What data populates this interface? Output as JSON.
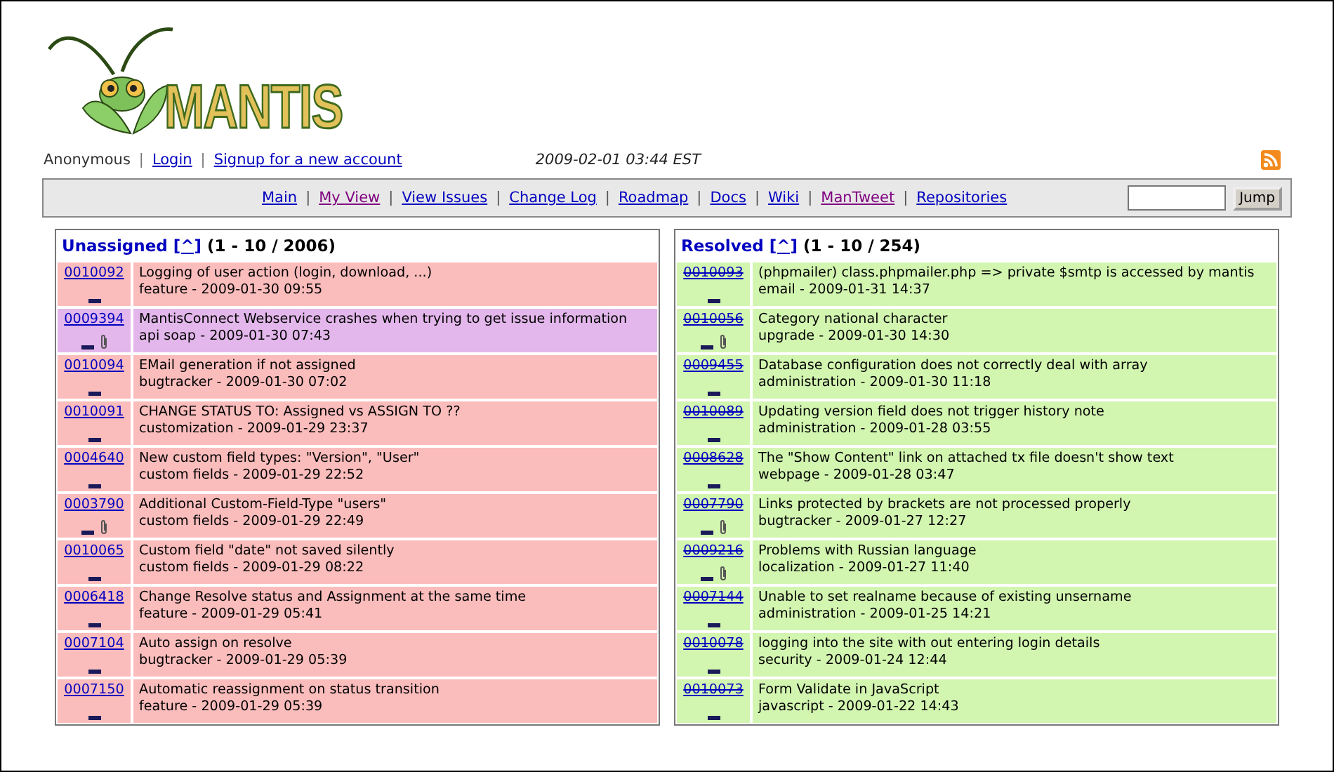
{
  "logo": {
    "text": "MANTIS"
  },
  "user_bar": {
    "user": "Anonymous",
    "separator": "|",
    "links": [
      {
        "label": "Login"
      },
      {
        "label": "Signup for a new account"
      }
    ],
    "datetime": "2009-02-01 03:44 EST"
  },
  "nav": {
    "separator": "|",
    "links": [
      {
        "label": "Main",
        "visited": false
      },
      {
        "label": "My View",
        "visited": true
      },
      {
        "label": "View Issues",
        "visited": false
      },
      {
        "label": "Change Log",
        "visited": false
      },
      {
        "label": "Roadmap",
        "visited": false
      },
      {
        "label": "Docs",
        "visited": false
      },
      {
        "label": "Wiki",
        "visited": false
      },
      {
        "label": "ManTweet",
        "visited": true
      },
      {
        "label": "Repositories",
        "visited": false
      }
    ],
    "jump_button": "Jump"
  },
  "panels": [
    {
      "title": "Unassigned",
      "toggle": "[^]",
      "range": "(1 - 10 / 2006)",
      "issues": [
        {
          "id": "0010092",
          "summary": "Logging of user action (login, download, ...)",
          "meta": "feature - 2009-01-30 09:55",
          "color": "#fbbcbc",
          "resolved": false,
          "attachment": false
        },
        {
          "id": "0009394",
          "summary": "MantisConnect Webservice crashes when trying to get issue information",
          "meta": "api soap - 2009-01-30 07:43",
          "color": "#e3b7eb",
          "resolved": false,
          "attachment": true
        },
        {
          "id": "0010094",
          "summary": "EMail generation if not assigned",
          "meta": "bugtracker - 2009-01-30 07:02",
          "color": "#fbbcbc",
          "resolved": false,
          "attachment": false
        },
        {
          "id": "0010091",
          "summary": "CHANGE STATUS TO: Assigned vs ASSIGN TO ??",
          "meta": "customization - 2009-01-29 23:37",
          "color": "#fbbcbc",
          "resolved": false,
          "attachment": false
        },
        {
          "id": "0004640",
          "summary": "New custom field types: \"Version\", \"User\"",
          "meta": "custom fields - 2009-01-29 22:52",
          "color": "#fbbcbc",
          "resolved": false,
          "attachment": false
        },
        {
          "id": "0003790",
          "summary": "Additional Custom-Field-Type \"users\"",
          "meta": "custom fields - 2009-01-29 22:49",
          "color": "#fbbcbc",
          "resolved": false,
          "attachment": true
        },
        {
          "id": "0010065",
          "summary": "Custom field \"date\" not saved silently",
          "meta": "custom fields - 2009-01-29 08:22",
          "color": "#fbbcbc",
          "resolved": false,
          "attachment": false
        },
        {
          "id": "0006418",
          "summary": "Change Resolve status and Assignment at the same time",
          "meta": "feature - 2009-01-29 05:41",
          "color": "#fbbcbc",
          "resolved": false,
          "attachment": false
        },
        {
          "id": "0007104",
          "summary": "Auto assign on resolve",
          "meta": "bugtracker - 2009-01-29 05:39",
          "color": "#fbbcbc",
          "resolved": false,
          "attachment": false
        },
        {
          "id": "0007150",
          "summary": "Automatic reassignment on status transition",
          "meta": "feature - 2009-01-29 05:39",
          "color": "#fbbcbc",
          "resolved": false,
          "attachment": false
        }
      ]
    },
    {
      "title": "Resolved",
      "toggle": "[^]",
      "range": "(1 - 10 / 254)",
      "issues": [
        {
          "id": "0010093",
          "summary": "(phpmailer) class.phpmailer.php => private $smtp is accessed by mantis",
          "meta": "email - 2009-01-31 14:37",
          "color": "#d2f5b0",
          "resolved": true,
          "attachment": false
        },
        {
          "id": "0010056",
          "summary": "Category national character",
          "meta": "upgrade - 2009-01-30 14:30",
          "color": "#d2f5b0",
          "resolved": true,
          "attachment": true
        },
        {
          "id": "0009455",
          "summary": "Database configuration does not correctly deal with array",
          "meta": "administration - 2009-01-30 11:18",
          "color": "#d2f5b0",
          "resolved": true,
          "attachment": false
        },
        {
          "id": "0010089",
          "summary": "Updating version field does not trigger history note",
          "meta": "administration - 2009-01-28 03:55",
          "color": "#d2f5b0",
          "resolved": true,
          "attachment": false
        },
        {
          "id": "0008628",
          "summary": "The \"Show Content\" link on attached tx file doesn't show text",
          "meta": "webpage - 2009-01-28 03:47",
          "color": "#d2f5b0",
          "resolved": true,
          "attachment": false
        },
        {
          "id": "0007790",
          "summary": "Links protected by brackets are not processed properly",
          "meta": "bugtracker - 2009-01-27 12:27",
          "color": "#d2f5b0",
          "resolved": true,
          "attachment": true
        },
        {
          "id": "0009216",
          "summary": "Problems with Russian language",
          "meta": "localization - 2009-01-27 11:40",
          "color": "#d2f5b0",
          "resolved": true,
          "attachment": true
        },
        {
          "id": "0007144",
          "summary": "Unable to set realname because of existing unsername",
          "meta": "administration - 2009-01-25 14:21",
          "color": "#d2f5b0",
          "resolved": true,
          "attachment": false
        },
        {
          "id": "0010078",
          "summary": "logging into the site with out entering login details",
          "meta": "security - 2009-01-24 12:44",
          "color": "#d2f5b0",
          "resolved": true,
          "attachment": false
        },
        {
          "id": "0010073",
          "summary": "Form Validate in JavaScript",
          "meta": "javascript - 2009-01-22 14:43",
          "color": "#d2f5b0",
          "resolved": true,
          "attachment": false
        }
      ]
    }
  ]
}
